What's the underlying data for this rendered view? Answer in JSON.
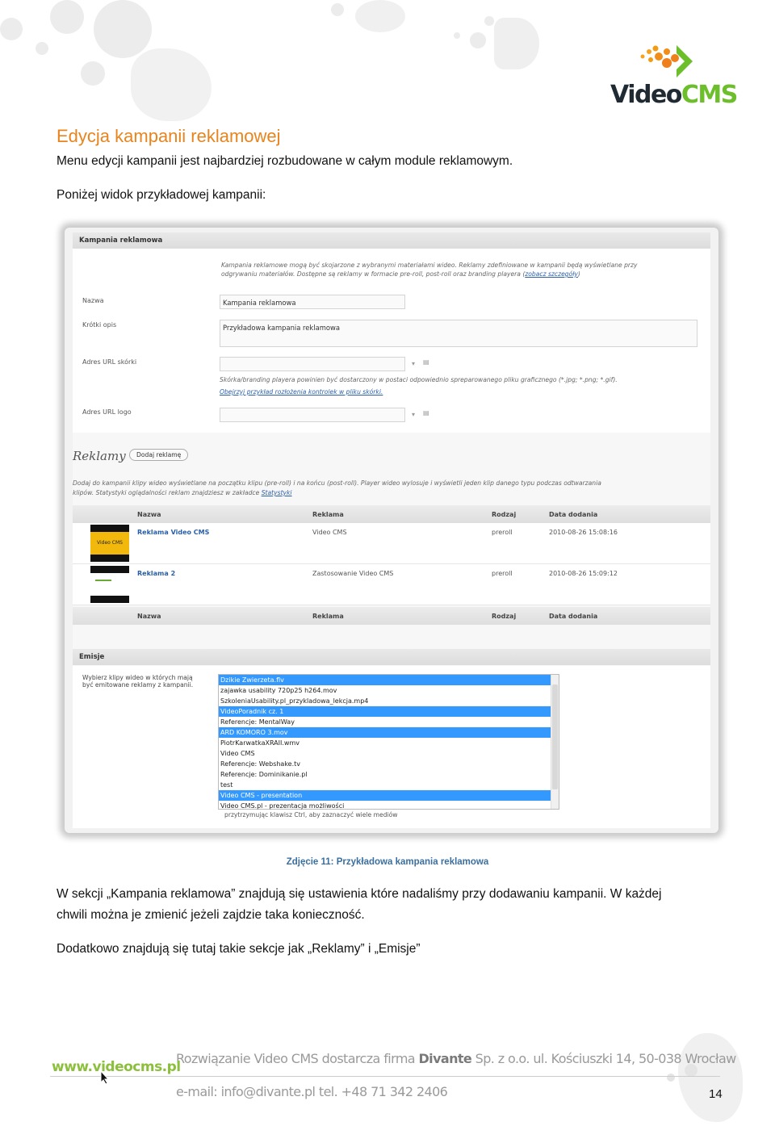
{
  "logo": {
    "part1": "Video",
    "part2": "CMS",
    "accent": "#6cbf2b"
  },
  "heading": "Edycja kampanii reklamowej",
  "para1": "Menu edycji kampanii jest najbardziej rozbudowane w całym module reklamowym.",
  "para2": "Poniżej widok przykładowej kampanii:",
  "screenshot": {
    "section1_title": "Kampania reklamowa",
    "intro_line1": "Kampania reklamowe mogą być skojarzone z wybranymi materiałami wideo. Reklamy zdefiniowane w kampanii będą wyświetlane przy",
    "intro_line2": "odgrywaniu materiałów. Dostępne są reklamy w formacie pre-roll, post-roll oraz branding playera (",
    "intro_link": "zobacz szczegóły",
    "intro_end": ")",
    "label_name": "Nazwa",
    "value_name": "Kampania reklamowa",
    "label_desc": "Krótki opis",
    "value_desc": "Przykładowa kampania reklamowa",
    "label_skin": "Adres URL skórki",
    "skin_note": "Skórka/branding playera powinien być dostarczony w postaci odpowiednio spreparowanego pliku graficznego (*.jpg; *.png; *.gif).",
    "skin_link": "Obejrzyj przykład rozłożenia kontrolek w pliku skórki.",
    "label_logo": "Adres URL logo",
    "reklamy_title": "Reklamy",
    "add_button": "Dodaj reklamę",
    "reklamy_desc1": "Dodaj do kampanii klipy wideo wyświetlane na początku klipu (pre-roll) i na końcu (post-roll). Player wideo wylosuje i wyświetli jeden klip danego typu podczas odtwarzania",
    "reklamy_desc2": "klipów. Statystyki oglądalności reklam znajdziesz w zakładce ",
    "reklamy_link": "Statystyki",
    "columns": [
      "Nazwa",
      "Reklama",
      "Rodzaj",
      "Data dodania"
    ],
    "rows": [
      {
        "name": "Reklama Video CMS",
        "ad": "Video CMS",
        "type": "preroll",
        "date": "2010-08-26 15:08:16",
        "thumb_text": "Video CMS"
      },
      {
        "name": "Reklama 2",
        "ad": "Zastosowanie Video CMS",
        "type": "preroll",
        "date": "2010-08-26 15:09:12"
      }
    ],
    "emisje_title": "Emisje",
    "emisje_label": "Wybierz klipy wideo w których mają być emitowane reklamy z kampanii.",
    "videos": [
      {
        "label": "Dzikie Zwierzeta.flv",
        "selected": true
      },
      {
        "label": "zajawka usability 720p25 h264.mov",
        "selected": false
      },
      {
        "label": "SzkoleniaUsability.pl_przykladowa_lekcja.mp4",
        "selected": false
      },
      {
        "label": "VideoPoradnik cz. 1",
        "selected": true
      },
      {
        "label": "Referencje: MentalWay",
        "selected": false
      },
      {
        "label": "ARD KOMORO 3.mov",
        "selected": true
      },
      {
        "label": "PiotrKarwatkaXRAII.wmv",
        "selected": false
      },
      {
        "label": "Video CMS",
        "selected": false
      },
      {
        "label": "Referencje: Webshake.tv",
        "selected": false
      },
      {
        "label": "Referencje: Dominikanie.pl",
        "selected": false
      },
      {
        "label": "test",
        "selected": false
      },
      {
        "label": "Video CMS - presentation",
        "selected": true
      },
      {
        "label": "Video CMS.pl - prezentacja możliwości",
        "selected": false
      }
    ],
    "hint": "przytrzymując klawisz Ctrl, aby zaznaczyć wiele mediów"
  },
  "caption": "Zdjęcie 11: Przykładowa kampania reklamowa",
  "para3a": "W sekcji „Kampania reklamowa” znajdują się ustawienia które nadaliśmy przy dodawaniu kampanii. W każdej",
  "para3b": "chwili można je zmienić jeżeli zajdzie taka konieczność.",
  "para4": "Dodatkowo znajdują się tutaj takie sekcje jak „Reklamy” i „Emisje”",
  "footer": {
    "website": "www.videocms.pl",
    "line1_pre": "Rozwiązanie Video CMS  dostarcza firma ",
    "line1_company": "Divante",
    "line1_post": " Sp. z o.o. ul. Kościuszki 14, 50-038 Wrocław",
    "line2": "e-mail: info@divante.pl tel. +48 71 342 2406",
    "page": "14"
  }
}
